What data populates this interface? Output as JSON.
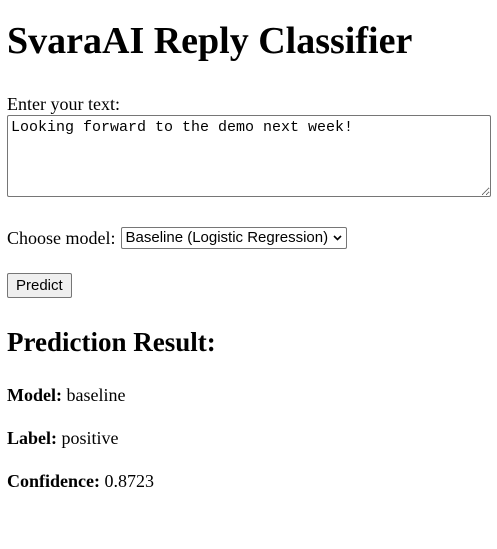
{
  "page": {
    "title": "SvaraAI Reply Classifier"
  },
  "form": {
    "text_label": "Enter your text:",
    "text_value": "Looking forward to the demo next week!",
    "model_label": "Choose model:",
    "model_selected": "Baseline (Logistic Regression)",
    "predict_label": "Predict"
  },
  "result": {
    "heading": "Prediction Result:",
    "model_key": "Model:",
    "model_value": "baseline",
    "label_key": "Label:",
    "label_value": "positive",
    "confidence_key": "Confidence:",
    "confidence_value": "0.8723"
  },
  "icons": {
    "select_chevron": "chevron-down-icon",
    "textarea_grip": "resize-grip-icon"
  },
  "colors": {
    "control_border": "#767676",
    "button_background": "#efefef",
    "text": "#000000",
    "background": "#ffffff"
  }
}
